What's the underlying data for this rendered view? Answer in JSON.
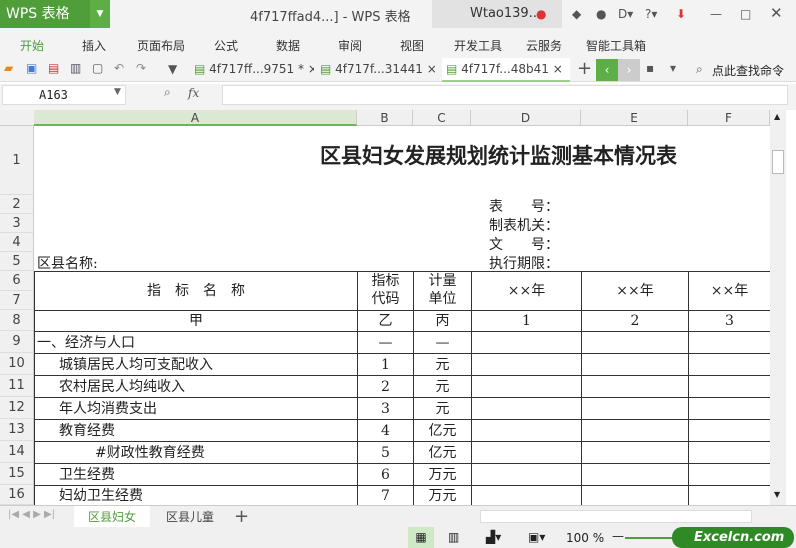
{
  "titlebar": {
    "app": "WPS 表格",
    "window_title": "4f717ffad4...] - WPS 表格",
    "user": "Wtao139..."
  },
  "menu": [
    "开始",
    "插入",
    "页面布局",
    "公式",
    "数据",
    "审阅",
    "视图",
    "开发工具",
    "云服务",
    "智能工具箱"
  ],
  "doc_tabs": [
    {
      "label": "4f717ff...9751 *",
      "close": "×"
    },
    {
      "label": "4f717f...31441",
      "close": "×"
    },
    {
      "label": "4f717f...48b41",
      "close": "×"
    }
  ],
  "search_cmd": "点此查找命令",
  "name_box": "A163",
  "fx_label": "fx",
  "formula": "",
  "columns": [
    "A",
    "B",
    "C",
    "D",
    "E",
    "F"
  ],
  "row_numbers": [
    "1",
    "2",
    "3",
    "4",
    "5",
    "6",
    "7",
    "8",
    "9",
    "10",
    "11",
    "12",
    "13",
    "14",
    "15",
    "16"
  ],
  "sheet": {
    "title": "区县妇女发展规划统计监测基本情况表",
    "meta": [
      "表　　号：",
      "制表机关：",
      "文　　号：",
      "执行期限："
    ],
    "district_label": "区县名称:",
    "header": {
      "name": "指　标　名　称",
      "code": "指标\n代码",
      "unit": "计量\n单位",
      "years": [
        "××年",
        "××年",
        "××年"
      ]
    },
    "index_row": [
      "甲",
      "乙",
      "丙",
      "1",
      "2",
      "3"
    ],
    "rows": [
      {
        "name": "一、经济与人口",
        "code": "—",
        "unit": "—",
        "indent": 0
      },
      {
        "name": "城镇居民人均可支配收入",
        "code": "1",
        "unit": "元",
        "indent": 1
      },
      {
        "name": "农村居民人均纯收入",
        "code": "2",
        "unit": "元",
        "indent": 1
      },
      {
        "name": "年人均消费支出",
        "code": "3",
        "unit": "元",
        "indent": 1
      },
      {
        "name": "教育经费",
        "code": "4",
        "unit": "亿元",
        "indent": 1
      },
      {
        "name": "#财政性教育经费",
        "code": "5",
        "unit": "亿元",
        "indent": 2
      },
      {
        "name": "卫生经费",
        "code": "6",
        "unit": "万元",
        "indent": 1
      },
      {
        "name": "妇幼卫生经费",
        "code": "7",
        "unit": "万元",
        "indent": 1
      }
    ]
  },
  "sheet_tabs": [
    "区县妇女",
    "区县儿童"
  ],
  "add_sheet": "+",
  "zoom": "100 %",
  "watermark": "Excelcn.com"
}
